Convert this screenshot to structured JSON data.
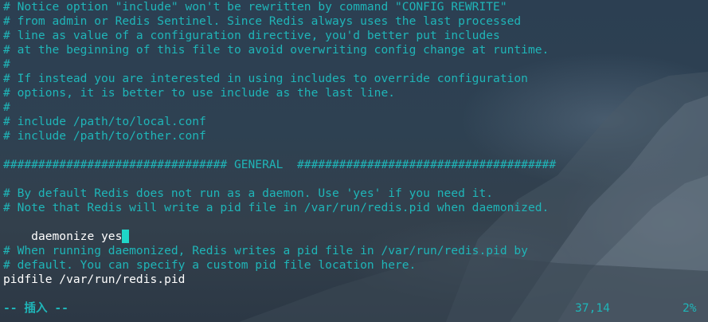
{
  "editor": {
    "lines": [
      {
        "text": "# Notice option \"include\" won't be rewritten by command \"CONFIG REWRITE\"",
        "type": "comment"
      },
      {
        "text": "# from admin or Redis Sentinel. Since Redis always uses the last processed",
        "type": "comment"
      },
      {
        "text": "# line as value of a configuration directive, you'd better put includes",
        "type": "comment"
      },
      {
        "text": "# at the beginning of this file to avoid overwriting config change at runtime.",
        "type": "comment"
      },
      {
        "text": "#",
        "type": "comment"
      },
      {
        "text": "# If instead you are interested in using includes to override configuration",
        "type": "comment"
      },
      {
        "text": "# options, it is better to use include as the last line.",
        "type": "comment"
      },
      {
        "text": "#",
        "type": "comment"
      },
      {
        "text": "# include /path/to/local.conf",
        "type": "comment"
      },
      {
        "text": "# include /path/to/other.conf",
        "type": "comment"
      },
      {
        "text": "",
        "type": "blank"
      },
      {
        "text": "################################ GENERAL  #####################################",
        "type": "comment"
      },
      {
        "text": "",
        "type": "blank"
      },
      {
        "text": "# By default Redis does not run as a daemon. Use 'yes' if you need it.",
        "type": "comment"
      },
      {
        "text": "# Note that Redis will write a pid file in /var/run/redis.pid when daemonized.",
        "type": "comment"
      },
      {
        "text": "daemonize yes",
        "type": "code"
      },
      {
        "text": "",
        "type": "blank"
      },
      {
        "text": "# When running daemonized, Redis writes a pid file in /var/run/redis.pid by",
        "type": "comment"
      },
      {
        "text": "# default. You can specify a custom pid file location here.",
        "type": "comment"
      },
      {
        "text": "pidfile /var/run/redis.pid",
        "type": "code"
      }
    ]
  },
  "status_bar": {
    "mode": "-- 插入 --",
    "position": "37,14",
    "percent": "2%"
  },
  "colors": {
    "comment": "#1fb5b8",
    "code": "#ffffff",
    "cursor": "#1fd6c8"
  }
}
